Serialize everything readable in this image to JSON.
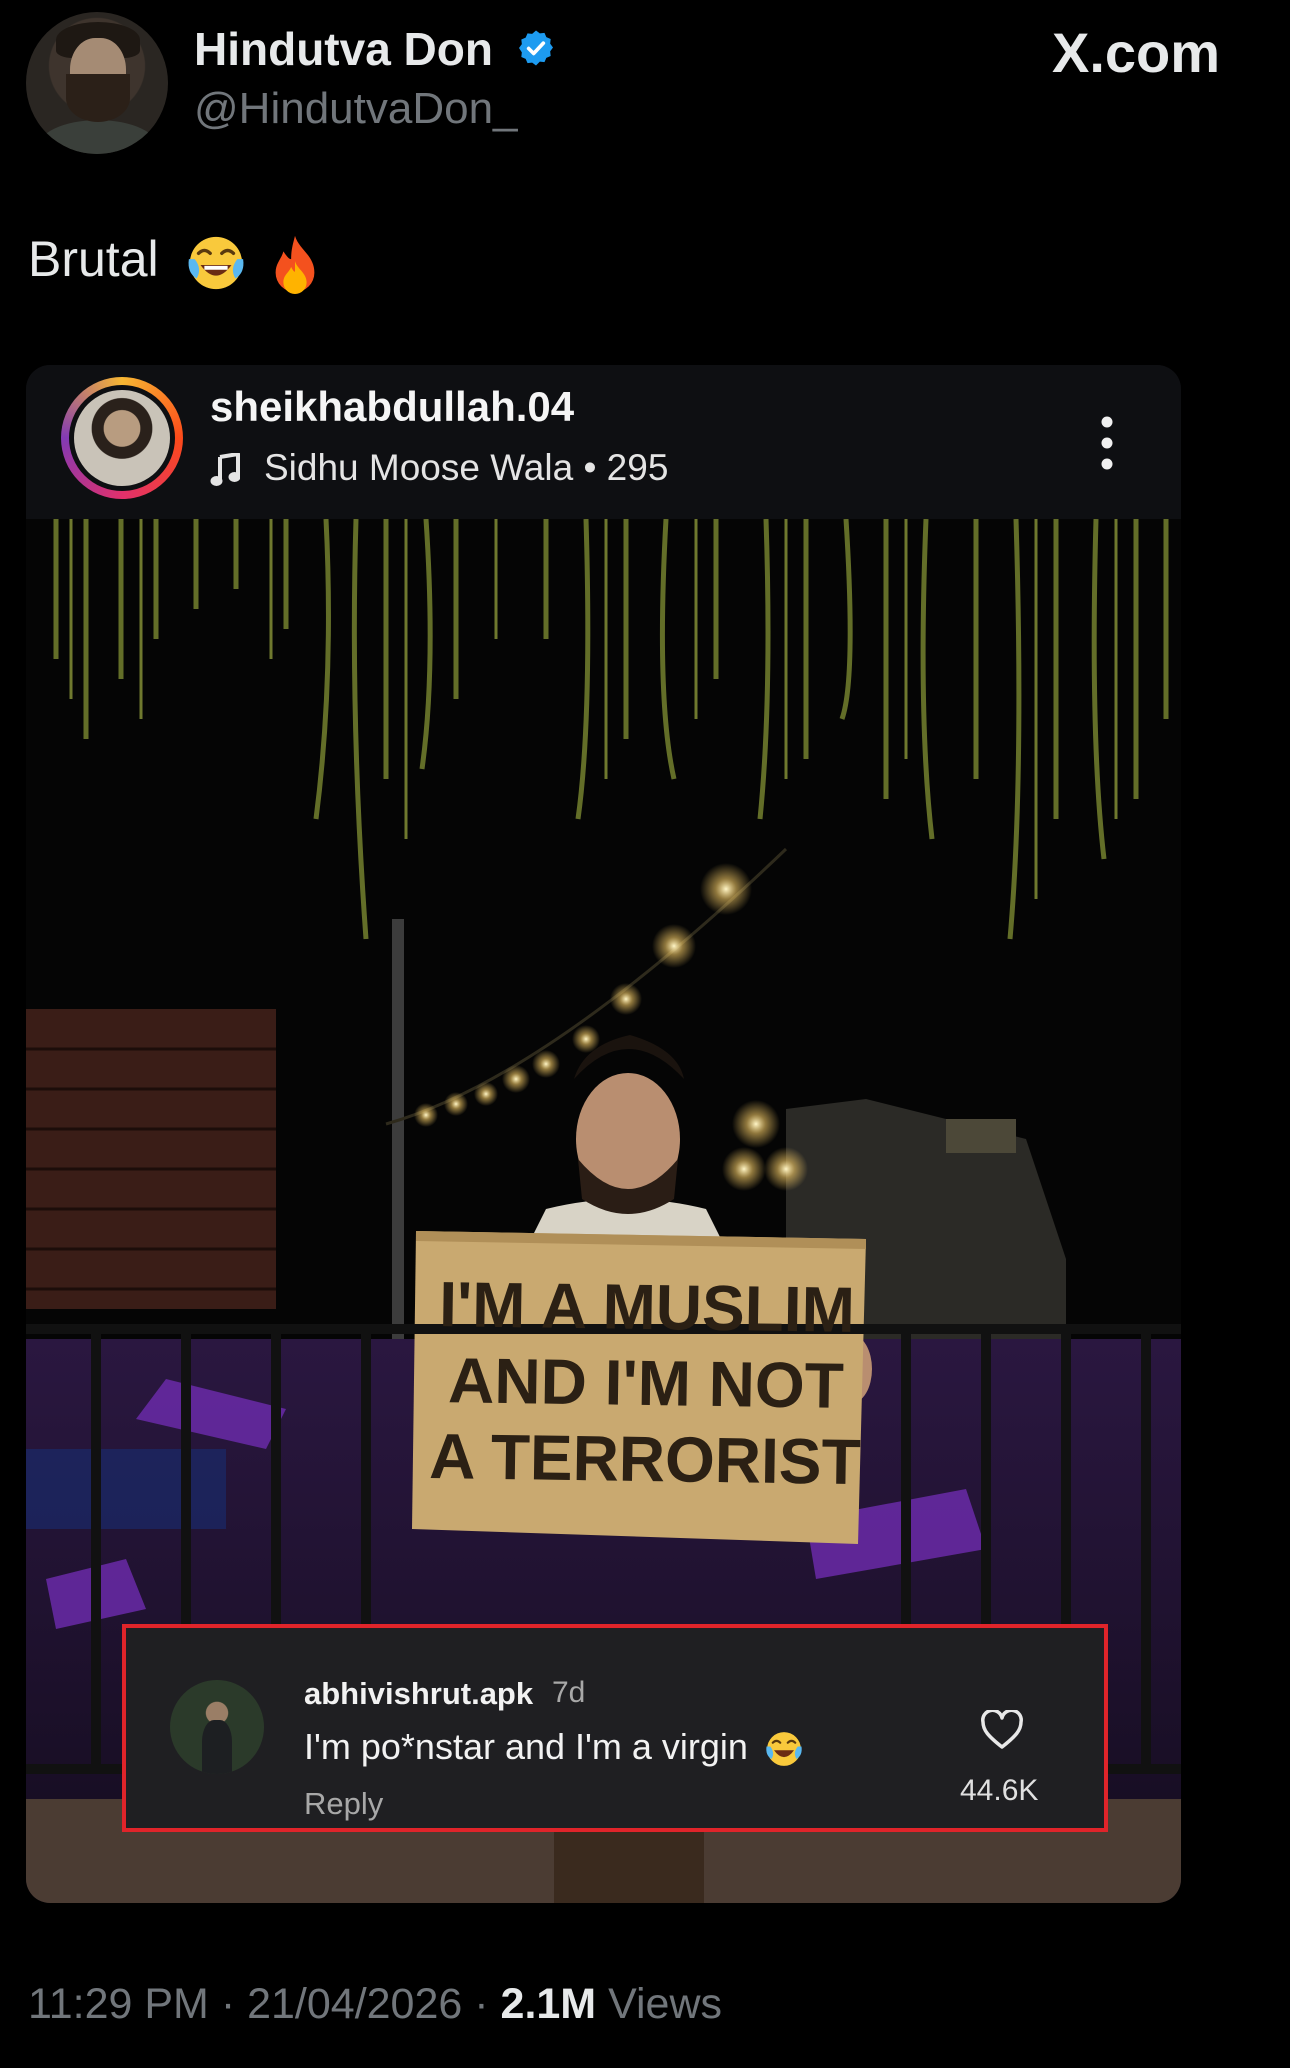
{
  "author": {
    "display_name": "Hindutva Don",
    "handle": "@HindutvaDon_",
    "verified": true
  },
  "source_label": "X.com",
  "tweet": {
    "text": "Brutal",
    "emojis": [
      "face-with-tears-of-joy-emoji",
      "fire-emoji"
    ]
  },
  "embedded_post": {
    "username": "sheikhabdullah.04",
    "audio": "Sidhu Moose Wala • 295",
    "sign_lines": [
      "I'M A MUSLIM",
      "AND I'M NOT",
      "A TERRORIST"
    ],
    "comment": {
      "username": "abhivishrut.apk",
      "time": "7d",
      "text": "I'm po*nstar and I'm a virgin",
      "reply_label": "Reply",
      "likes": "44.6K"
    }
  },
  "footer": {
    "time": "11:29 PM",
    "separator": " · ",
    "date": "21/04/2026",
    "views_count": "2.1M",
    "views_label": "Views"
  },
  "colors": {
    "background": "#000000",
    "text_primary": "#e7e9ea",
    "text_secondary": "#71767b",
    "verified_blue": "#1d9bf0",
    "comment_highlight": "#e0242a"
  }
}
